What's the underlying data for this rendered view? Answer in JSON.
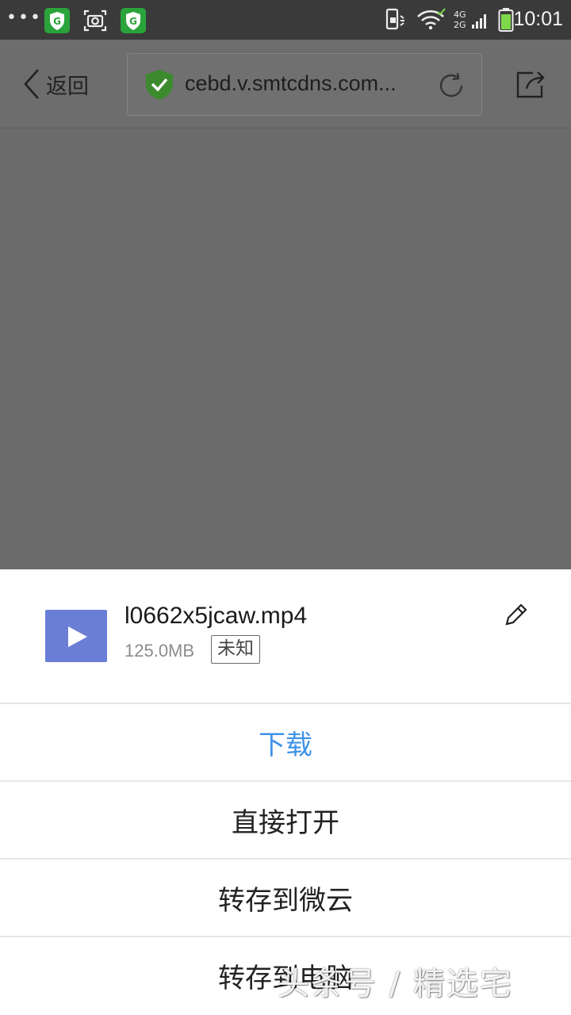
{
  "status_bar": {
    "time": "10:01",
    "signal_label_top": "4G",
    "signal_label_bottom": "2G",
    "icons": [
      "more-dots-icon",
      "guard-app-icon",
      "screenshot-icon",
      "guard-app-icon",
      "phone-vibrate-icon",
      "wifi-icon",
      "cell-signal-icon",
      "battery-icon"
    ]
  },
  "toolbar": {
    "back_label": "返回",
    "url": "cebd.v.smtcdns.com...",
    "secure_color": "#3c8a2e"
  },
  "sheet": {
    "file_name": "l0662x5jcaw.mp4",
    "file_size": "125.0MB",
    "file_tag": "未知",
    "thumb_color": "#6b7ed6",
    "actions": [
      {
        "label": "下载",
        "primary": true
      },
      {
        "label": "直接打开"
      },
      {
        "label": "转存到微云"
      },
      {
        "label": "转存到电脑"
      }
    ]
  },
  "watermark": "头条号 / 精选宅",
  "colors": {
    "accent": "#3f93e6",
    "overlay": "#6b6b6b"
  }
}
